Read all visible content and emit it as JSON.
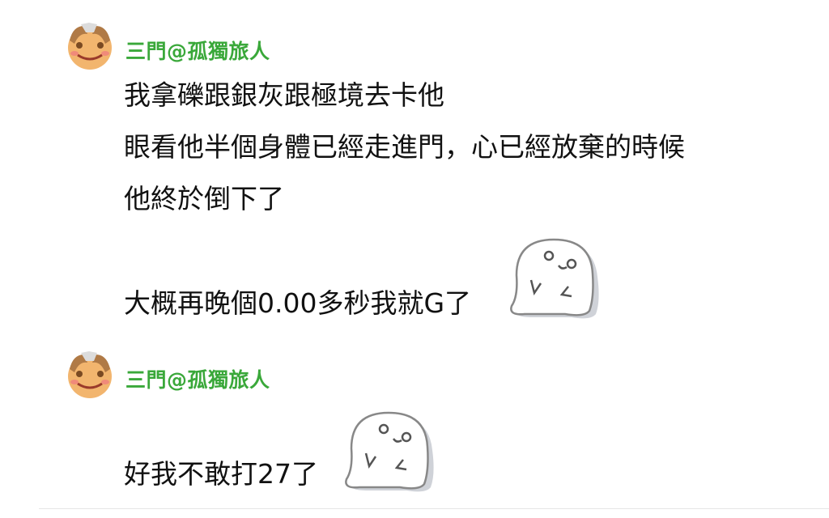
{
  "messages": [
    {
      "sender": "三門@孤獨旅人",
      "lines": [
        "我拿礫跟銀灰跟極境去卡他",
        "眼看他半個身體已經走進門，心已經放棄的時候",
        "他終於倒下了",
        "大概再晚個0.00多秒我就G了"
      ],
      "sticker": "ghost-shrug-sticker"
    },
    {
      "sender": "三門@孤獨旅人",
      "lines": [
        "好我不敢打27了"
      ],
      "sticker": "ghost-shrug-sticker"
    }
  ],
  "colors": {
    "sender": "#3aa83a",
    "text": "#111111",
    "background": "#ffffff"
  }
}
